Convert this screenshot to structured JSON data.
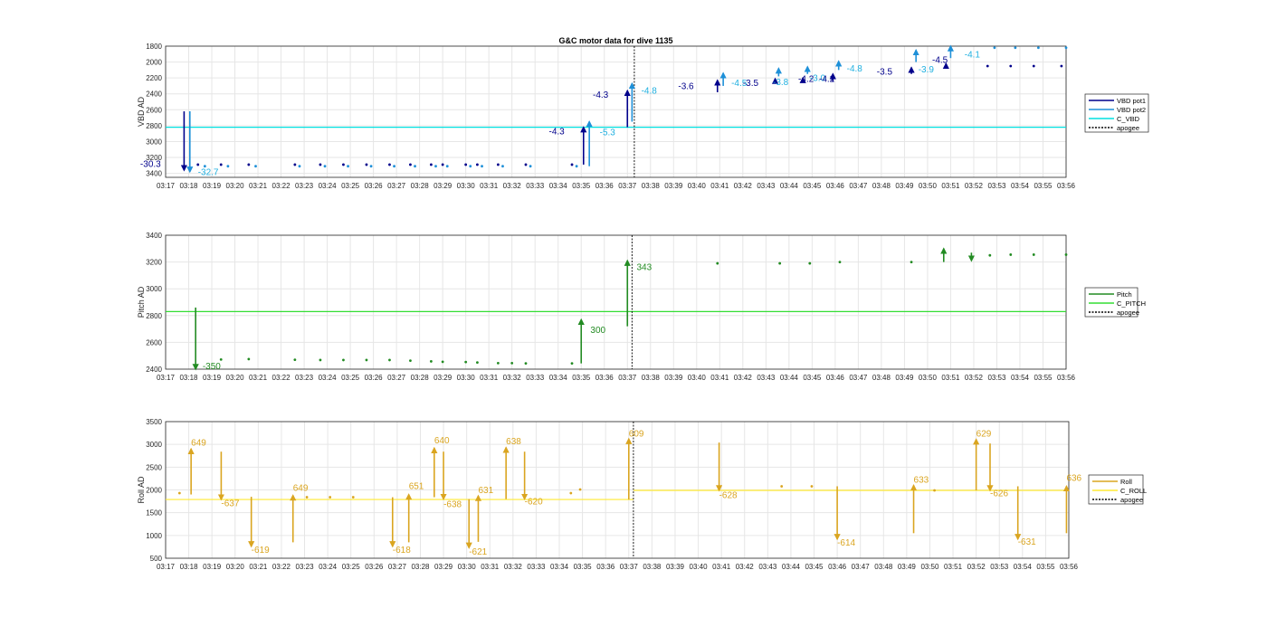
{
  "chart_data": [
    {
      "type": "line",
      "title": "G&C motor data for dive 1135",
      "ylabel": "VBD AD",
      "ylim": [
        3450,
        1800
      ],
      "yticks": [
        1800,
        2000,
        2200,
        2400,
        2600,
        2800,
        3000,
        3200,
        3400
      ],
      "xticks": [
        "03:17",
        "03:18",
        "03:19",
        "03:20",
        "03:21",
        "03:22",
        "03:23",
        "03:24",
        "03:25",
        "03:26",
        "03:27",
        "03:28",
        "03:29",
        "03:30",
        "03:31",
        "03:32",
        "03:33",
        "03:34",
        "03:35",
        "03:36",
        "03:37",
        "03:38",
        "03:39",
        "03:40",
        "03:41",
        "03:42",
        "03:43",
        "03:44",
        "03:45",
        "03:46",
        "03:47",
        "03:48",
        "03:49",
        "03:50",
        "03:51",
        "03:52",
        "03:53",
        "03:54",
        "03:55",
        "03:56"
      ],
      "apogee": 20.3,
      "constant_lines": [
        {
          "name": "C_VBD",
          "value": 2820,
          "color": "#00e0e0"
        }
      ],
      "legend": {
        "location": "right",
        "entries": [
          {
            "label": "VBD pot1",
            "color": "#00008b",
            "style": "solid"
          },
          {
            "label": "VBD pot2",
            "color": "#1e90d8",
            "style": "solid"
          },
          {
            "label": "C_VBD",
            "color": "#00e0e0",
            "style": "solid"
          },
          {
            "label": "apogee",
            "color": "#000000",
            "style": "dotted"
          }
        ]
      },
      "dots": [
        {
          "x": 1.4,
          "y": 3290,
          "s": "p1"
        },
        {
          "x": 1.7,
          "y": 3310,
          "s": "p2"
        },
        {
          "x": 2.4,
          "y": 3290,
          "s": "p1"
        },
        {
          "x": 2.7,
          "y": 3310,
          "s": "p2"
        },
        {
          "x": 3.6,
          "y": 3290,
          "s": "p1"
        },
        {
          "x": 3.9,
          "y": 3310,
          "s": "p2"
        },
        {
          "x": 5.6,
          "y": 3290,
          "s": "p1"
        },
        {
          "x": 5.8,
          "y": 3310,
          "s": "p2"
        },
        {
          "x": 6.7,
          "y": 3290,
          "s": "p1"
        },
        {
          "x": 6.9,
          "y": 3310,
          "s": "p2"
        },
        {
          "x": 7.7,
          "y": 3290,
          "s": "p1"
        },
        {
          "x": 7.9,
          "y": 3310,
          "s": "p2"
        },
        {
          "x": 8.7,
          "y": 3290,
          "s": "p1"
        },
        {
          "x": 8.9,
          "y": 3310,
          "s": "p2"
        },
        {
          "x": 9.7,
          "y": 3290,
          "s": "p1"
        },
        {
          "x": 9.9,
          "y": 3310,
          "s": "p2"
        },
        {
          "x": 10.6,
          "y": 3290,
          "s": "p1"
        },
        {
          "x": 10.8,
          "y": 3310,
          "s": "p2"
        },
        {
          "x": 11.5,
          "y": 3290,
          "s": "p1"
        },
        {
          "x": 11.7,
          "y": 3310,
          "s": "p2"
        },
        {
          "x": 12.0,
          "y": 3290,
          "s": "p1"
        },
        {
          "x": 12.2,
          "y": 3310,
          "s": "p2"
        },
        {
          "x": 13.0,
          "y": 3290,
          "s": "p1"
        },
        {
          "x": 13.2,
          "y": 3310,
          "s": "p2"
        },
        {
          "x": 13.5,
          "y": 3290,
          "s": "p1"
        },
        {
          "x": 13.7,
          "y": 3310,
          "s": "p2"
        },
        {
          "x": 14.4,
          "y": 3290,
          "s": "p1"
        },
        {
          "x": 14.6,
          "y": 3310,
          "s": "p2"
        },
        {
          "x": 15.6,
          "y": 3290,
          "s": "p1"
        },
        {
          "x": 15.8,
          "y": 3310,
          "s": "p2"
        },
        {
          "x": 17.6,
          "y": 3290,
          "s": "p1"
        },
        {
          "x": 17.8,
          "y": 3310,
          "s": "p2"
        },
        {
          "x": 35.6,
          "y": 2050,
          "s": "p1"
        },
        {
          "x": 35.9,
          "y": 1820,
          "s": "p2"
        },
        {
          "x": 36.6,
          "y": 2050,
          "s": "p1"
        },
        {
          "x": 36.8,
          "y": 1820,
          "s": "p2"
        },
        {
          "x": 37.6,
          "y": 2050,
          "s": "p1"
        },
        {
          "x": 37.8,
          "y": 1820,
          "s": "p2"
        },
        {
          "x": 38.8,
          "y": 2050,
          "s": "p1"
        },
        {
          "x": 39.0,
          "y": 1820,
          "s": "p2"
        }
      ],
      "arrows": [
        {
          "x": 0.8,
          "y0": 2620,
          "y1": 3360,
          "s": "p1",
          "label": "-30.3",
          "lx": -1.1,
          "ly": 3320
        },
        {
          "x": 1.05,
          "y0": 2620,
          "y1": 3380,
          "s": "p2",
          "label": "-32.7",
          "lx": 1.4,
          "ly": 3420
        },
        {
          "x": 18.1,
          "y0": 3290,
          "y1": 2820,
          "s": "p1",
          "label": "-4.3",
          "lx": 16.6,
          "ly": 2910
        },
        {
          "x": 18.35,
          "y0": 3310,
          "y1": 2750,
          "s": "p2",
          "label": "-5.3",
          "lx": 18.8,
          "ly": 2920
        },
        {
          "x": 20.0,
          "y0": 2820,
          "y1": 2360,
          "s": "p1",
          "label": "-4.3",
          "lx": 18.5,
          "ly": 2450
        },
        {
          "x": 20.2,
          "y0": 2750,
          "y1": 2270,
          "s": "p2",
          "label": "-4.8",
          "lx": 20.6,
          "ly": 2400
        },
        {
          "x": 23.9,
          "y0": 2380,
          "y1": 2230,
          "s": "p1",
          "label": "-3.6",
          "lx": 22.2,
          "ly": 2340
        },
        {
          "x": 24.15,
          "y0": 2300,
          "y1": 2140,
          "s": "p2",
          "label": "-4.5",
          "lx": 24.5,
          "ly": 2300
        },
        {
          "x": 26.4,
          "y0": 2260,
          "y1": 2210,
          "s": "p1",
          "label": "-3.5",
          "lx": 25.0,
          "ly": 2300
        },
        {
          "x": 26.55,
          "y0": 2180,
          "y1": 2080,
          "s": "p2",
          "label": "-3.8",
          "lx": 26.3,
          "ly": 2290
        },
        {
          "x": 27.6,
          "y0": 2250,
          "y1": 2200,
          "s": "p1",
          "label": "-4.2",
          "lx": 27.4,
          "ly": 2250
        },
        {
          "x": 27.8,
          "y0": 2150,
          "y1": 2060,
          "s": "p2",
          "label": "-3.0",
          "lx": 27.9,
          "ly": 2240
        },
        {
          "x": 28.9,
          "y0": 2250,
          "y1": 2150,
          "s": "p1",
          "label": "-4.2",
          "lx": 28.3,
          "ly": 2250
        },
        {
          "x": 29.15,
          "y0": 2100,
          "y1": 1990,
          "s": "p2",
          "label": "-4.8",
          "lx": 29.5,
          "ly": 2120
        },
        {
          "x": 32.3,
          "y0": 2150,
          "y1": 2070,
          "s": "p1",
          "label": "-3.5",
          "lx": 30.8,
          "ly": 2160
        },
        {
          "x": 32.5,
          "y0": 2000,
          "y1": 1850,
          "s": "p2",
          "label": "-3.9",
          "lx": 32.6,
          "ly": 2130
        },
        {
          "x": 33.8,
          "y0": 2050,
          "y1": 2020,
          "s": "p1",
          "label": "-4.5",
          "lx": 33.2,
          "ly": 2010
        },
        {
          "x": 34.0,
          "y0": 1950,
          "y1": 1800,
          "s": "p2",
          "label": "-4.1",
          "lx": 34.6,
          "ly": 1940
        }
      ],
      "x_range": [
        0,
        39
      ]
    },
    {
      "type": "line",
      "ylabel": "Pitch AD",
      "ylim": [
        2400,
        3400
      ],
      "yticks": [
        2400,
        2600,
        2800,
        3000,
        3200,
        3400
      ],
      "xticks": [
        "03:17",
        "03:18",
        "03:19",
        "03:20",
        "03:21",
        "03:22",
        "03:23",
        "03:24",
        "03:25",
        "03:26",
        "03:27",
        "03:28",
        "03:29",
        "03:30",
        "03:31",
        "03:32",
        "03:33",
        "03:34",
        "03:35",
        "03:36",
        "03:37",
        "03:38",
        "03:39",
        "03:40",
        "03:41",
        "03:42",
        "03:43",
        "03:44",
        "03:45",
        "03:46",
        "03:47",
        "03:48",
        "03:49",
        "03:50",
        "03:51",
        "03:52",
        "03:53",
        "03:54",
        "03:55",
        "03:56"
      ],
      "apogee": 20.2,
      "constant_lines": [
        {
          "name": "C_PITCH",
          "value": 2830,
          "color": "#33dd33"
        }
      ],
      "legend": {
        "location": "right",
        "entries": [
          {
            "label": "Pitch",
            "color": "#228b22",
            "style": "solid"
          },
          {
            "label": "C_PITCH",
            "color": "#33dd33",
            "style": "solid"
          },
          {
            "label": "apogee",
            "color": "#000000",
            "style": "dotted"
          }
        ]
      },
      "dots": [
        {
          "x": 2.4,
          "y": 2472
        },
        {
          "x": 3.6,
          "y": 2475
        },
        {
          "x": 5.6,
          "y": 2470
        },
        {
          "x": 6.7,
          "y": 2468
        },
        {
          "x": 7.7,
          "y": 2468
        },
        {
          "x": 8.7,
          "y": 2468
        },
        {
          "x": 9.7,
          "y": 2468
        },
        {
          "x": 10.6,
          "y": 2463
        },
        {
          "x": 11.5,
          "y": 2458
        },
        {
          "x": 12.0,
          "y": 2455
        },
        {
          "x": 13.0,
          "y": 2453
        },
        {
          "x": 13.5,
          "y": 2450
        },
        {
          "x": 14.4,
          "y": 2445
        },
        {
          "x": 15.0,
          "y": 2445
        },
        {
          "x": 15.6,
          "y": 2443
        },
        {
          "x": 17.6,
          "y": 2443
        },
        {
          "x": 23.9,
          "y": 3190
        },
        {
          "x": 26.6,
          "y": 3190
        },
        {
          "x": 27.9,
          "y": 3190
        },
        {
          "x": 29.2,
          "y": 3200
        },
        {
          "x": 32.3,
          "y": 3200
        },
        {
          "x": 35.7,
          "y": 3250
        },
        {
          "x": 36.6,
          "y": 3255
        },
        {
          "x": 37.6,
          "y": 3255
        },
        {
          "x": 39.0,
          "y": 3255
        }
      ],
      "arrows": [
        {
          "x": 1.3,
          "y0": 2860,
          "y1": 2400,
          "label": "-350",
          "lx": 1.6,
          "ly": 2400
        },
        {
          "x": 18.0,
          "y0": 2443,
          "y1": 2770,
          "label": "300",
          "lx": 18.4,
          "ly": 2670
        },
        {
          "x": 20.0,
          "y0": 2720,
          "y1": 3210,
          "label": "343",
          "lx": 20.4,
          "ly": 3140
        },
        {
          "x": 33.7,
          "y0": 3200,
          "y1": 3300
        },
        {
          "x": 34.9,
          "y0": 3270,
          "y1": 3210
        }
      ],
      "x_range": [
        0,
        39
      ]
    },
    {
      "type": "line",
      "ylabel": "Roll AD",
      "ylim": [
        500,
        3500
      ],
      "yticks": [
        500,
        1000,
        1500,
        2000,
        2500,
        3000,
        3500
      ],
      "xticks": [
        "03:17",
        "03:18",
        "03:19",
        "03:20",
        "03:21",
        "03:22",
        "03:23",
        "03:24",
        "03:25",
        "03:26",
        "03:27",
        "03:28",
        "03:29",
        "03:30",
        "03:31",
        "03:32",
        "03:33",
        "03:34",
        "03:35",
        "03:36",
        "03:37",
        "03:38",
        "03:39",
        "03:40",
        "03:41",
        "03:42",
        "03:43",
        "03:44",
        "03:45",
        "03:46",
        "03:47",
        "03:48",
        "03:49",
        "03:50",
        "03:51",
        "03:52",
        "03:53",
        "03:54",
        "03:55",
        "03:56"
      ],
      "apogee": 20.2,
      "constant_lines": [
        {
          "name": "C_ROLL",
          "x0": 0,
          "x1": 20.2,
          "value": 1790,
          "color": "#ffea33"
        },
        {
          "name": "C_ROLL",
          "x0": 20.2,
          "x1": 39,
          "value": 1990,
          "color": "#ffea33"
        }
      ],
      "legend": {
        "location": "right",
        "entries": [
          {
            "label": "Roll",
            "color": "#daa520",
            "style": "solid"
          },
          {
            "label": "C_ROLL",
            "color": "#ffea33",
            "style": "solid"
          },
          {
            "label": "apogee",
            "color": "#000000",
            "style": "dotted"
          }
        ]
      },
      "dots": [
        {
          "x": 0.6,
          "y": 1930
        },
        {
          "x": 6.1,
          "y": 1840
        },
        {
          "x": 7.1,
          "y": 1840
        },
        {
          "x": 8.1,
          "y": 1840
        },
        {
          "x": 17.5,
          "y": 1930
        },
        {
          "x": 17.9,
          "y": 2010
        },
        {
          "x": 26.6,
          "y": 2080
        },
        {
          "x": 27.9,
          "y": 2080
        },
        {
          "x": 33.2,
          "y": 1990
        }
      ],
      "arrows": [
        {
          "x": 1.1,
          "y0": 1900,
          "y1": 2900,
          "label": "649",
          "lx": 1.1,
          "ly": 2970
        },
        {
          "x": 2.4,
          "y0": 2840,
          "y1": 1790,
          "label": "-637",
          "lx": 2.4,
          "ly": 1640
        },
        {
          "x": 3.7,
          "y0": 1850,
          "y1": 760,
          "label": "-619",
          "lx": 3.7,
          "ly": 620
        },
        {
          "x": 5.5,
          "y0": 850,
          "y1": 1880,
          "label": "649",
          "lx": 5.5,
          "ly": 1980
        },
        {
          "x": 9.8,
          "y0": 1840,
          "y1": 760,
          "label": "-618",
          "lx": 9.8,
          "ly": 620
        },
        {
          "x": 10.5,
          "y0": 850,
          "y1": 1900,
          "label": "651",
          "lx": 10.5,
          "ly": 2020
        },
        {
          "x": 11.6,
          "y0": 1840,
          "y1": 2920,
          "label": "640",
          "lx": 11.6,
          "ly": 3020
        },
        {
          "x": 12.0,
          "y0": 2840,
          "y1": 1800,
          "label": "-638",
          "lx": 12.0,
          "ly": 1620
        },
        {
          "x": 13.1,
          "y0": 1800,
          "y1": 730,
          "label": "-621",
          "lx": 13.1,
          "ly": 580
        },
        {
          "x": 13.5,
          "y0": 860,
          "y1": 1870,
          "label": "631",
          "lx": 13.5,
          "ly": 1930
        },
        {
          "x": 14.7,
          "y0": 1800,
          "y1": 2930,
          "label": "638",
          "lx": 14.7,
          "ly": 3000
        },
        {
          "x": 15.5,
          "y0": 2840,
          "y1": 1800,
          "label": "-620",
          "lx": 15.5,
          "ly": 1680
        },
        {
          "x": 20.0,
          "y0": 1790,
          "y1": 3120,
          "label": "609",
          "lx": 20.0,
          "ly": 3170
        },
        {
          "x": 23.9,
          "y0": 3040,
          "y1": 1990,
          "label": "-628",
          "lx": 23.9,
          "ly": 1820
        },
        {
          "x": 29.0,
          "y0": 2080,
          "y1": 920,
          "label": "-614",
          "lx": 29.0,
          "ly": 780
        },
        {
          "x": 32.3,
          "y0": 1050,
          "y1": 2100,
          "label": "633",
          "lx": 32.3,
          "ly": 2160
        },
        {
          "x": 35.0,
          "y0": 1990,
          "y1": 3110,
          "label": "629",
          "lx": 35.0,
          "ly": 3170
        },
        {
          "x": 35.6,
          "y0": 3020,
          "y1": 1990,
          "label": "-626",
          "lx": 35.6,
          "ly": 1860
        },
        {
          "x": 36.8,
          "y0": 2080,
          "y1": 920,
          "label": "-631",
          "lx": 36.8,
          "ly": 800
        },
        {
          "x": 38.9,
          "y0": 1050,
          "y1": 2080,
          "label": "636",
          "lx": 38.9,
          "ly": 2200
        }
      ],
      "x_range": [
        0,
        39
      ]
    }
  ],
  "colors": {
    "p1": "#00008b",
    "p2": "#1e90d8",
    "p1_label": "#00008b",
    "p2_label": "#20b0e0",
    "pitch": "#228b22",
    "roll": "#daa520"
  }
}
